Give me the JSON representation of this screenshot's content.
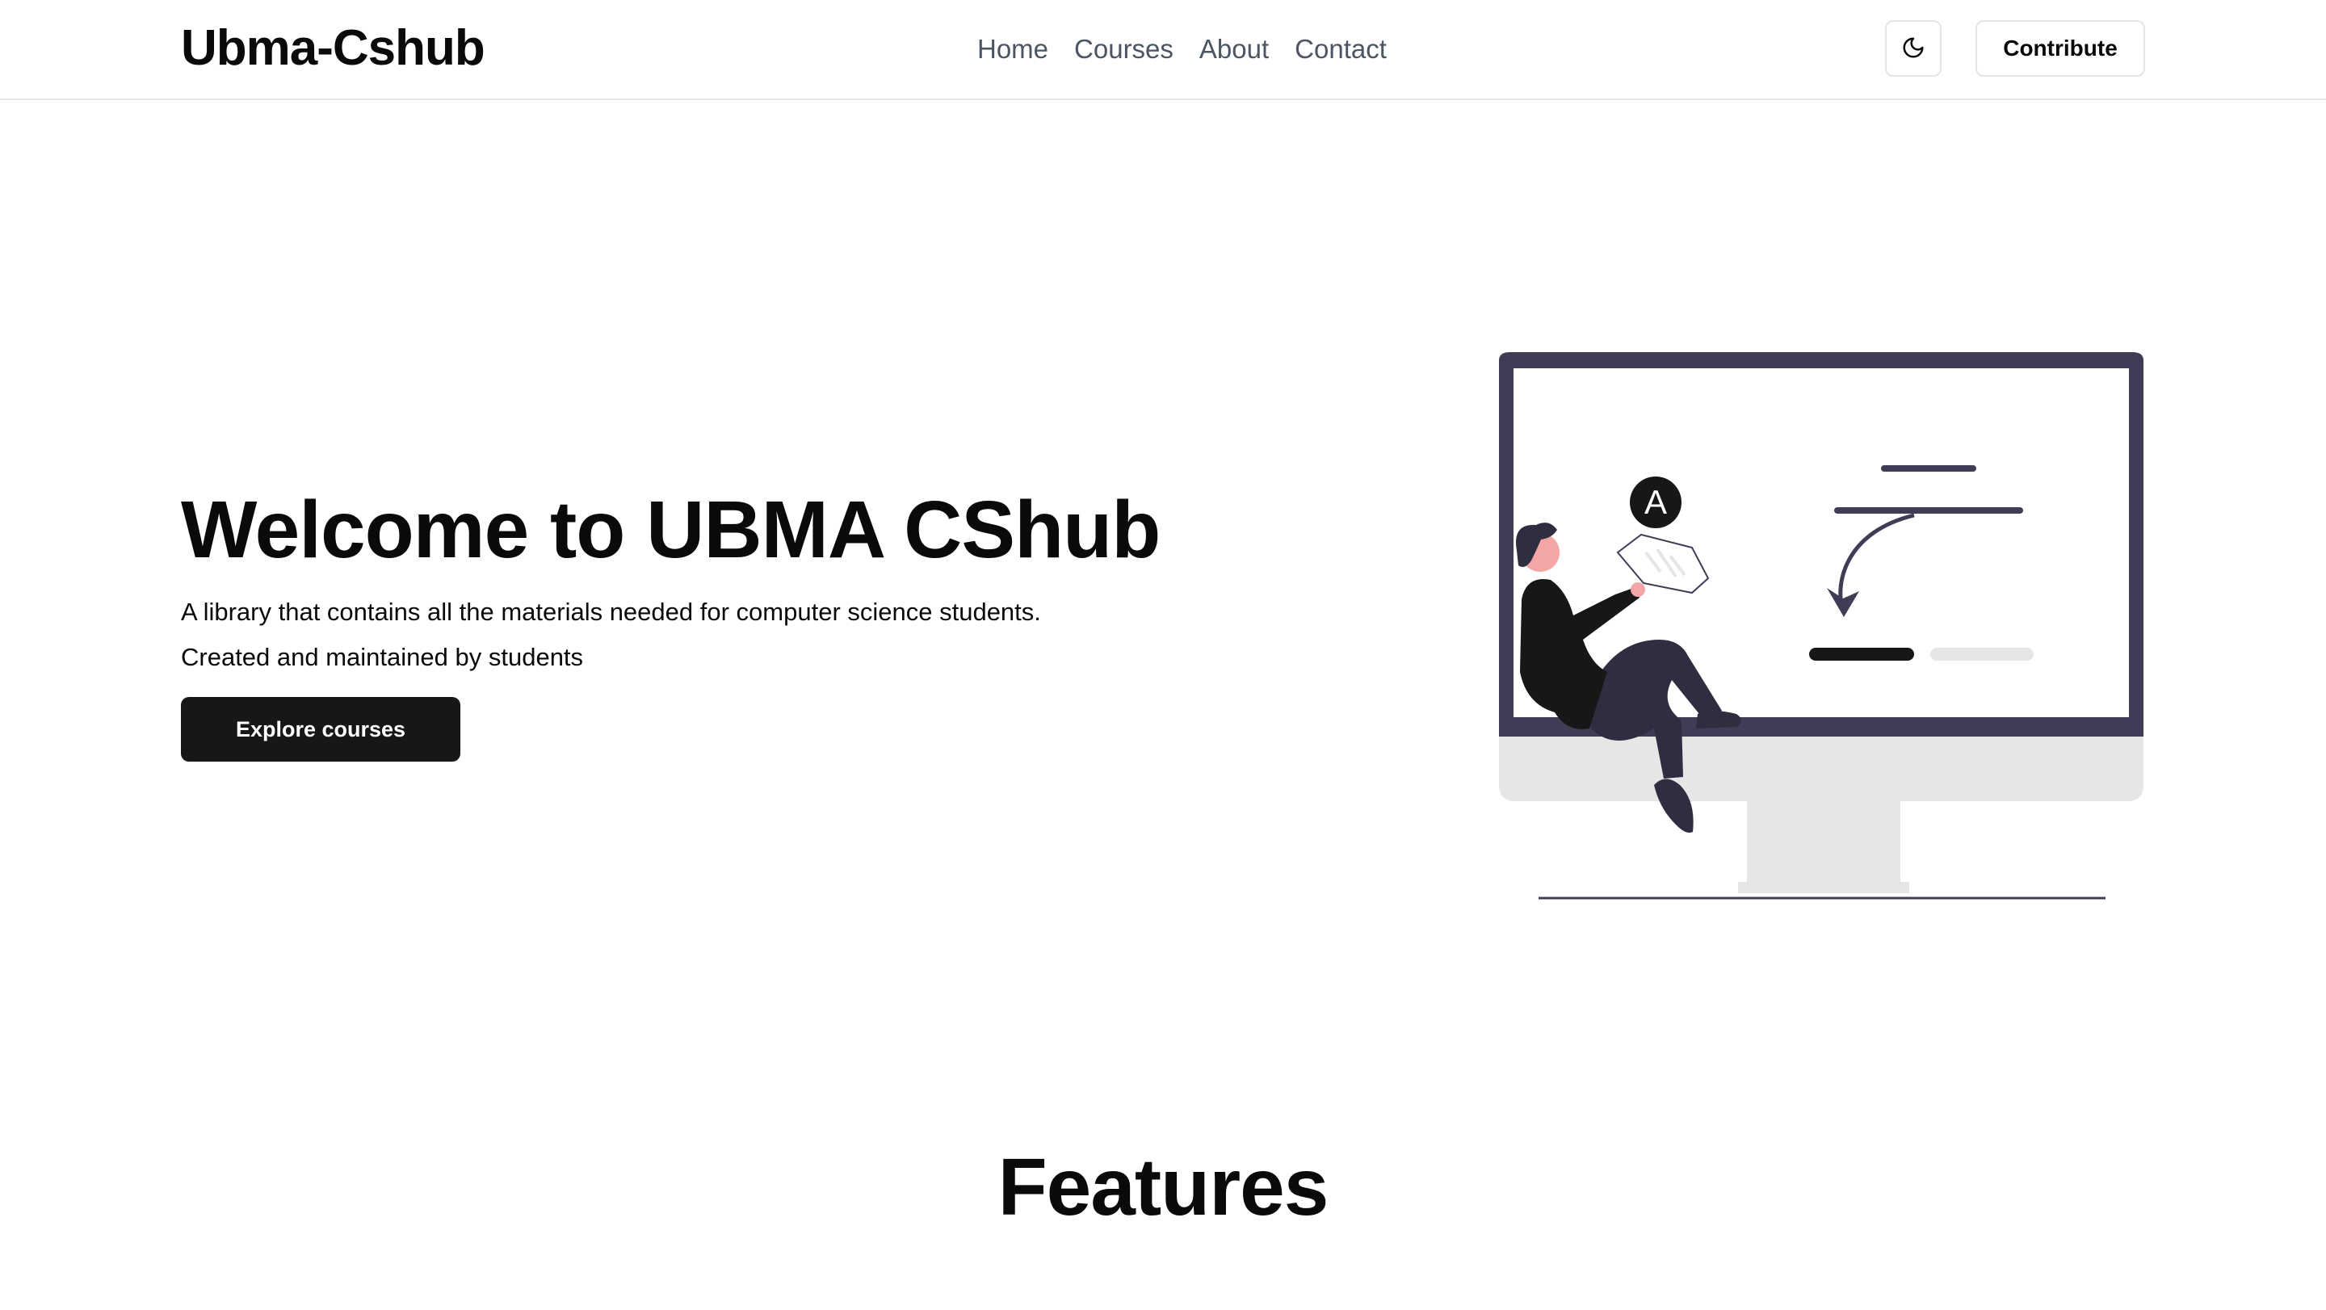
{
  "header": {
    "brand": "Ubma-Cshub",
    "nav": [
      "Home",
      "Courses",
      "About",
      "Contact"
    ],
    "theme_icon": "moon-icon",
    "contribute_label": "Contribute"
  },
  "hero": {
    "title": "Welcome to UBMA CShub",
    "description_lines": [
      "A library that contains all the materials needed for computer science students.",
      "Created and maintained by students"
    ],
    "cta_label": "Explore courses",
    "illustration": {
      "icon": "person-sitting-on-monitor-illustration",
      "badge_letter": "A"
    }
  },
  "features": {
    "title": "Features"
  },
  "colors": {
    "primary": "#171717",
    "text": "#0a0a0a",
    "muted_text": "#4b5563",
    "border": "#e5e5e5",
    "illustration_dark": "#3f3d56",
    "illustration_light": "#e6e6e6"
  }
}
